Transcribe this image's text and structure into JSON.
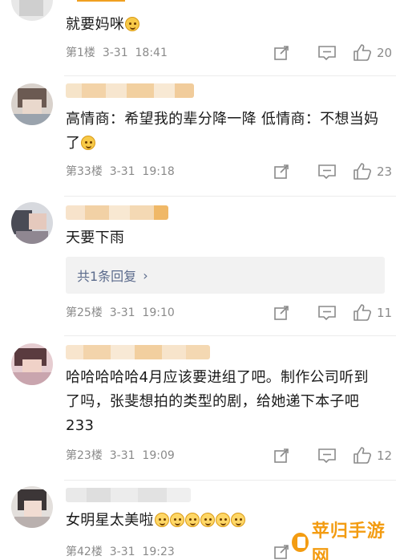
{
  "comments": [
    {
      "text": "就要妈咪",
      "floor": "第1楼",
      "date": "3-31",
      "time": "18:41",
      "likes": "20"
    },
    {
      "text": "高情商：希望我的辈分降一降    低情商：不想当妈了",
      "floor": "第33楼",
      "date": "3-31",
      "time": "19:18",
      "likes": "23"
    },
    {
      "text": "天要下雨",
      "reply_label": "共1条回复",
      "floor": "第25楼",
      "date": "3-31",
      "time": "19:10",
      "likes": "11"
    },
    {
      "text": "哈哈哈哈哈4月应该要进组了吧。制作公司听到了吗，张斐想拍的类型的剧，给她递下本子吧233",
      "floor": "第23楼",
      "date": "3-31",
      "time": "19:09",
      "likes": "12"
    },
    {
      "text": "女明星太美啦",
      "floor": "第42楼",
      "date": "3-31",
      "time": "19:23",
      "likes": ""
    }
  ],
  "icons": {
    "forward": "share-forward-icon",
    "comment": "comment-bubble-icon",
    "like": "thumbs-up-icon",
    "reply_chevron": "chevron-right-icon"
  },
  "colors": {
    "meta_gray": "#8a8a8a",
    "reply_link": "#5b6b8c",
    "reply_bg": "#f2f2f2",
    "watermark": "#f39c12"
  },
  "watermark": {
    "text": "苹归手游网"
  }
}
